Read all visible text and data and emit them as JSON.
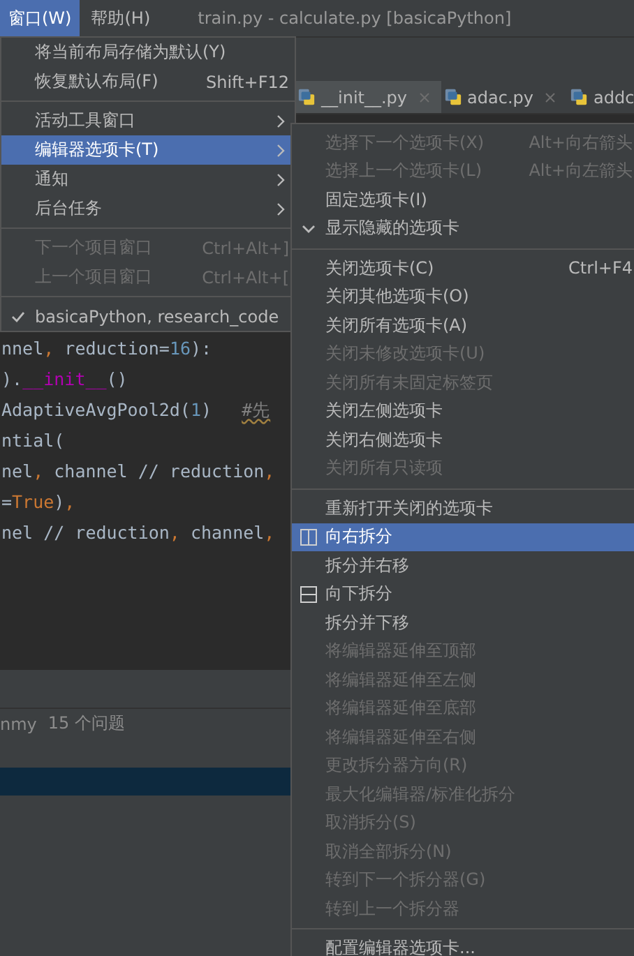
{
  "menubar": {
    "menus": [
      {
        "label": "窗口(W)",
        "selected": true
      },
      {
        "label": "帮助(H)",
        "selected": false
      }
    ],
    "title": "train.py - calculate.py [basicaPython]"
  },
  "editor_tabs": [
    {
      "label": "__init__.py",
      "closable": true,
      "selected": true
    },
    {
      "label": "adac.py",
      "closable": true,
      "selected": false
    },
    {
      "label": "addc",
      "closable": false,
      "selected": false
    }
  ],
  "code_lines": [
    [
      {
        "kind": "plain",
        "text": "nnel"
      },
      {
        "kind": "punct",
        "text": ", "
      },
      {
        "kind": "plain",
        "text": "reduction="
      },
      {
        "kind": "number",
        "text": "16"
      },
      {
        "kind": "plain",
        "text": "):"
      }
    ],
    [
      {
        "kind": "plain",
        "text": ")."
      },
      {
        "kind": "magic",
        "text": "__init__"
      },
      {
        "kind": "plain",
        "text": "()"
      }
    ],
    [
      {
        "kind": "plain",
        "text": " AdaptiveAvgPool2d("
      },
      {
        "kind": "number",
        "text": "1"
      },
      {
        "kind": "plain",
        "text": ")   "
      },
      {
        "kind": "comment",
        "text": "#先"
      }
    ],
    [
      {
        "kind": "plain",
        "text": "ntial("
      }
    ],
    [
      {
        "kind": "plain",
        "text": "nel"
      },
      {
        "kind": "punct",
        "text": ", "
      },
      {
        "kind": "plain",
        "text": "channel // reduction"
      },
      {
        "kind": "punct",
        "text": ","
      }
    ],
    [
      {
        "kind": "plain",
        "text": "="
      },
      {
        "kind": "keyword",
        "text": "True"
      },
      {
        "kind": "plain",
        "text": ")"
      },
      {
        "kind": "punct",
        "text": ","
      }
    ],
    [
      {
        "kind": "plain",
        "text": "nel // reduction"
      },
      {
        "kind": "punct",
        "text": ", "
      },
      {
        "kind": "plain",
        "text": "channel"
      },
      {
        "kind": "punct",
        "text": ","
      }
    ]
  ],
  "problems_bar": {
    "label": "nmy",
    "count": "15 个问题"
  },
  "window_menu": [
    {
      "kind": "item",
      "label": "将当前布局存储为默认(Y)",
      "disabled": false,
      "selected": false,
      "checked": false,
      "submenu": false
    },
    {
      "kind": "item",
      "label": "恢复默认布局(F)",
      "shortcut": "Shift+F12",
      "disabled": false,
      "selected": false,
      "checked": false,
      "submenu": false
    },
    {
      "kind": "separator"
    },
    {
      "kind": "item",
      "label": "活动工具窗口",
      "disabled": false,
      "selected": false,
      "checked": false,
      "submenu": true
    },
    {
      "kind": "item",
      "label": "编辑器选项卡(T)",
      "disabled": false,
      "selected": true,
      "checked": false,
      "submenu": true
    },
    {
      "kind": "item",
      "label": "通知",
      "disabled": false,
      "selected": false,
      "checked": false,
      "submenu": true
    },
    {
      "kind": "item",
      "label": "后台任务",
      "disabled": false,
      "selected": false,
      "checked": false,
      "submenu": true
    },
    {
      "kind": "separator"
    },
    {
      "kind": "item",
      "label": "下一个项目窗口",
      "shortcut": "Ctrl+Alt+]",
      "disabled": true,
      "selected": false,
      "checked": false,
      "submenu": false
    },
    {
      "kind": "item",
      "label": "上一个项目窗口",
      "shortcut": "Ctrl+Alt+[",
      "disabled": true,
      "selected": false,
      "checked": false,
      "submenu": false
    },
    {
      "kind": "separator"
    },
    {
      "kind": "item",
      "label": "basicaPython, research_code",
      "disabled": false,
      "selected": false,
      "checked": true,
      "submenu": false
    }
  ],
  "tabs_submenu": [
    {
      "kind": "item",
      "label": "选择下一个选项卡(X)",
      "shortcut": "Alt+向右箭头",
      "disabled": true,
      "selected": false,
      "checked": false
    },
    {
      "kind": "item",
      "label": "选择上一个选项卡(L)",
      "shortcut": "Alt+向左箭头",
      "disabled": true,
      "selected": false,
      "checked": false
    },
    {
      "kind": "item",
      "label": "固定选项卡(I)",
      "disabled": false,
      "selected": false,
      "checked": false
    },
    {
      "kind": "item",
      "label": "显示隐藏的选项卡",
      "disabled": false,
      "selected": false,
      "checked": true
    },
    {
      "kind": "separator"
    },
    {
      "kind": "item",
      "label": "关闭选项卡(C)",
      "shortcut": "Ctrl+F4",
      "disabled": false,
      "selected": false,
      "checked": false
    },
    {
      "kind": "item",
      "label": "关闭其他选项卡(O)",
      "disabled": false,
      "selected": false,
      "checked": false
    },
    {
      "kind": "item",
      "label": "关闭所有选项卡(A)",
      "disabled": false,
      "selected": false,
      "checked": false
    },
    {
      "kind": "item",
      "label": "关闭未修改选项卡(U)",
      "disabled": true,
      "selected": false,
      "checked": false
    },
    {
      "kind": "item",
      "label": "关闭所有未固定标签页",
      "disabled": true,
      "selected": false,
      "checked": false
    },
    {
      "kind": "item",
      "label": "关闭左侧选项卡",
      "disabled": false,
      "selected": false,
      "checked": false
    },
    {
      "kind": "item",
      "label": "关闭右侧选项卡",
      "disabled": false,
      "selected": false,
      "checked": false
    },
    {
      "kind": "item",
      "label": "关闭所有只读项",
      "disabled": true,
      "selected": false,
      "checked": false
    },
    {
      "kind": "separator"
    },
    {
      "kind": "item",
      "label": "重新打开关闭的选项卡",
      "disabled": false,
      "selected": false,
      "checked": false
    },
    {
      "kind": "vsplit",
      "label": "向右拆分",
      "disabled": false,
      "selected": true,
      "checked": false
    },
    {
      "kind": "item",
      "label": "拆分并右移",
      "disabled": false,
      "selected": false,
      "checked": false
    },
    {
      "kind": "hsplit",
      "label": "向下拆分",
      "disabled": false,
      "selected": false,
      "checked": false
    },
    {
      "kind": "item",
      "label": "拆分并下移",
      "disabled": false,
      "selected": false,
      "checked": false
    },
    {
      "kind": "item",
      "label": "将编辑器延伸至顶部",
      "disabled": true,
      "selected": false,
      "checked": false
    },
    {
      "kind": "item",
      "label": "将编辑器延伸至左侧",
      "disabled": true,
      "selected": false,
      "checked": false
    },
    {
      "kind": "item",
      "label": "将编辑器延伸至底部",
      "disabled": true,
      "selected": false,
      "checked": false
    },
    {
      "kind": "item",
      "label": "将编辑器延伸至右侧",
      "disabled": true,
      "selected": false,
      "checked": false
    },
    {
      "kind": "item",
      "label": "更改拆分器方向(R)",
      "disabled": true,
      "selected": false,
      "checked": false
    },
    {
      "kind": "item",
      "label": "最大化编辑器/标准化拆分",
      "disabled": true,
      "selected": false,
      "checked": false
    },
    {
      "kind": "item",
      "label": "取消拆分(S)",
      "disabled": true,
      "selected": false,
      "checked": false
    },
    {
      "kind": "item",
      "label": "取消全部拆分(N)",
      "disabled": true,
      "selected": false,
      "checked": false
    },
    {
      "kind": "item",
      "label": "转到下一个拆分器(G)",
      "disabled": true,
      "selected": false,
      "checked": false
    },
    {
      "kind": "item",
      "label": "转到上一个拆分器",
      "disabled": true,
      "selected": false,
      "checked": false
    },
    {
      "kind": "separator"
    },
    {
      "kind": "item",
      "label": "配置编辑器选项卡...",
      "disabled": false,
      "selected": false,
      "checked": false
    }
  ]
}
